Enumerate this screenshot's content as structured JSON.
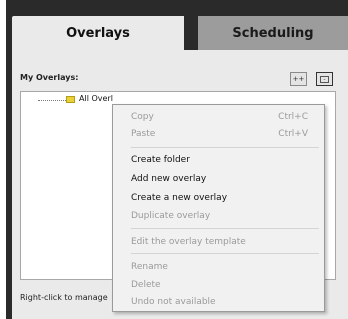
{
  "tabs": [
    {
      "label": "Overlays",
      "active": true
    },
    {
      "label": "Scheduling",
      "active": false
    }
  ],
  "panel": {
    "section_label": "My Overlays:",
    "expand_button": "++",
    "collapse_button": "-",
    "tree": {
      "root_label": "All Overlays",
      "icon": "folder-icon"
    },
    "status_text": "Right-click to manage"
  },
  "context_menu": {
    "items": [
      {
        "label": "Copy",
        "shortcut": "Ctrl+C",
        "enabled": false
      },
      {
        "label": "Paste",
        "shortcut": "Ctrl+V",
        "enabled": false
      },
      {
        "label": "Create folder",
        "shortcut": "",
        "enabled": true
      },
      {
        "label": "Add new overlay",
        "shortcut": "",
        "enabled": true
      },
      {
        "label": "Create a new overlay",
        "shortcut": "",
        "enabled": true
      },
      {
        "label": "Duplicate overlay",
        "shortcut": "",
        "enabled": false
      },
      {
        "label": "Edit the overlay template",
        "shortcut": "",
        "enabled": false
      },
      {
        "label": "Rename",
        "shortcut": "",
        "enabled": false
      },
      {
        "label": "Delete",
        "shortcut": "",
        "enabled": false
      },
      {
        "label": "Undo not available",
        "shortcut": "",
        "enabled": false
      }
    ]
  },
  "colors": {
    "tab_active_bg": "#eaeaea",
    "tab_inactive_bg": "#9c9c9c",
    "frame_dark": "#2a2a2a",
    "folder_yellow": "#e8d23a",
    "disabled_text": "#9a9a9a"
  }
}
